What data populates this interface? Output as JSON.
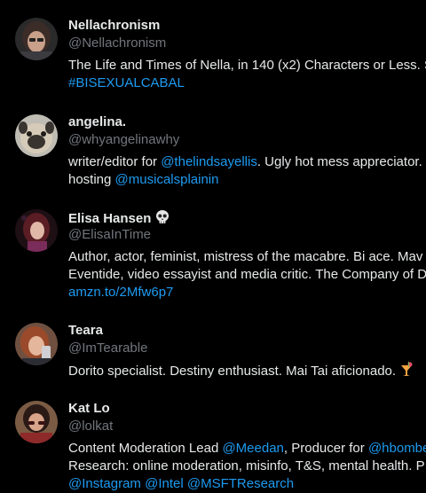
{
  "colors": {
    "background": "#000000",
    "text_primary": "#e7e9ea",
    "text_secondary": "#71767b",
    "link": "#1d9bf0"
  },
  "users": [
    {
      "display_name": "Nellachronism",
      "handle": "@Nellachronism",
      "bio_line1": "The Life and Times of Nella, in 140 (x2) Characters or Less. S",
      "bio_line2_hashtag": "#BISEXUALCABAL"
    },
    {
      "display_name": "angelina.",
      "handle": "@whyangelinawhy",
      "bio_line1_prefix": "writer/editor for ",
      "bio_line1_mention": "@thelindsayellis",
      "bio_line1_suffix": ". Ugly hot mess appreciator. ",
      "bio_line2_prefix": "hosting ",
      "bio_line2_mention": "@musicalsplainin"
    },
    {
      "display_name": "Elisa Hansen",
      "name_emoji": "skull-emoji",
      "handle": "@ElisaInTime",
      "bio_line1": "Author, actor, feminist, mistress of the macabre. Bi ace. Mav",
      "bio_line2": "Eventide, video essayist and media critic. The Company of D",
      "bio_line3_link": "amzn.to/2Mfw6p7"
    },
    {
      "display_name": "Teara",
      "handle": "@ImTearable",
      "bio_line1": "Dorito specialist. Destiny enthusiast. Mai Tai aficionado.",
      "bio_emoji": "tropical-drink-emoji"
    },
    {
      "display_name": "Kat Lo",
      "handle": "@lolkat",
      "bio_line1_prefix": "Content Moderation Lead ",
      "bio_line1_mention1": "@Meedan",
      "bio_line1_middle": ", Producer for ",
      "bio_line1_mention2": "@hbombe",
      "bio_line2": "Research: online moderation, misinfo, T&S, mental health. P",
      "bio_line3_mention1": "@Instagram",
      "bio_line3_mention2": "@Intel",
      "bio_line3_mention3": "@MSFTResearch"
    }
  ]
}
